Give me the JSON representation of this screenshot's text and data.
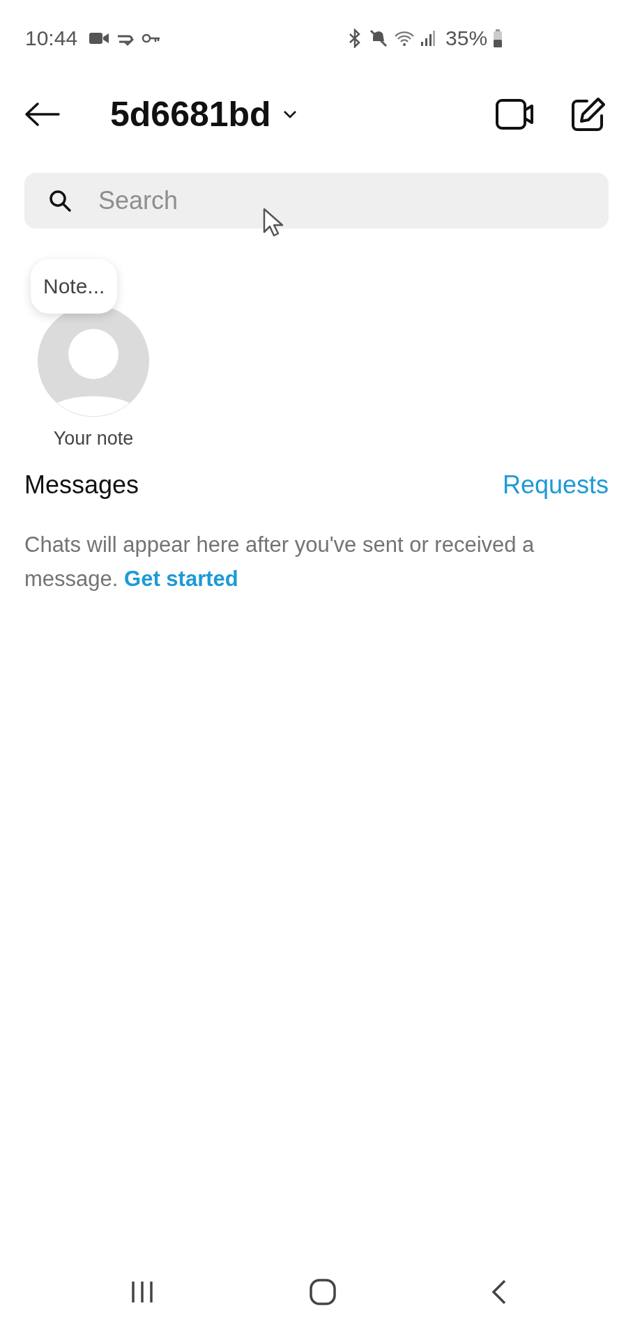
{
  "status_bar": {
    "time": "10:44",
    "battery": "35%"
  },
  "header": {
    "title": "5d6681bd"
  },
  "search": {
    "placeholder": "Search"
  },
  "note": {
    "bubble": "Note...",
    "label": "Your note"
  },
  "messages": {
    "heading": "Messages",
    "requests": "Requests"
  },
  "empty_state": {
    "text": "Chats will appear here after you've sent or received a message.",
    "link": "Get started"
  }
}
